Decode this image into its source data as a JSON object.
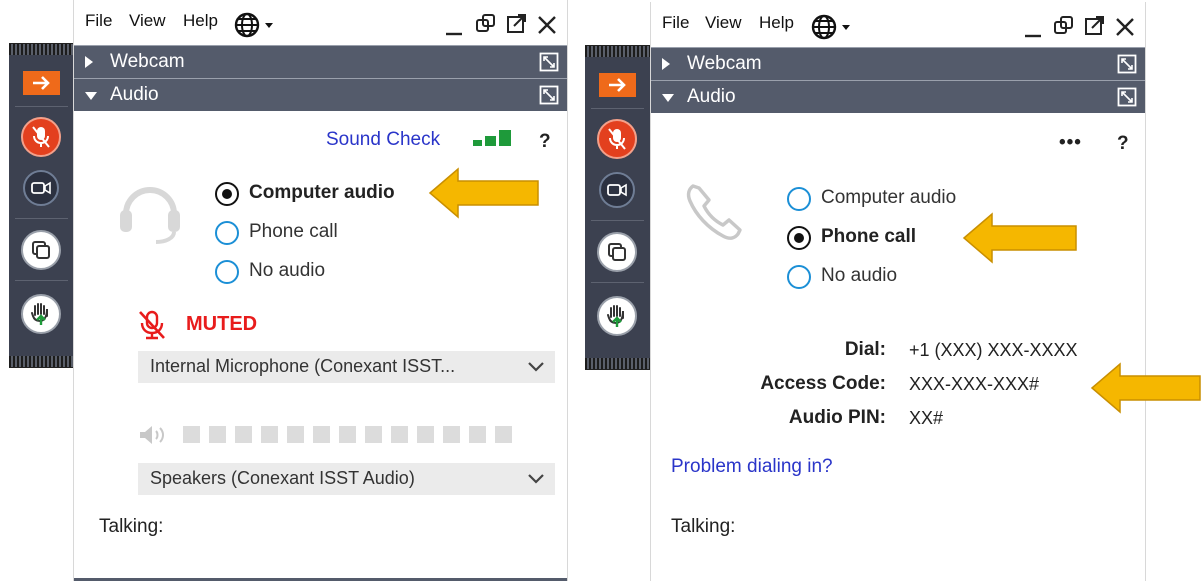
{
  "colors": {
    "toolbar_bg": "#3c4150",
    "section_bar": "#545b6b",
    "exit_orange": "#ef6a1a",
    "mic_red": "#e3401e",
    "muted_red": "#e81c1c",
    "link_blue": "#2a35c9",
    "radio_blue": "#1b8fd6",
    "signal_green": "#1e9a3a",
    "arrow_yellow": "#f5b700"
  },
  "menu": {
    "file": "File",
    "view": "View",
    "help": "Help",
    "language_icon": "globe-icon"
  },
  "window_controls": [
    "minimize-icon",
    "restore-icon",
    "popout-icon",
    "close-icon"
  ],
  "toolbar_icons": [
    "exit-arrow-icon",
    "mic-muted-icon",
    "camera-icon",
    "share-screen-icon",
    "raise-hand-icon"
  ],
  "sections": {
    "webcam": "Webcam",
    "audio": "Audio"
  },
  "left_panel": {
    "sound_check": "Sound Check",
    "help_mark": "?",
    "options": [
      {
        "label": "Computer audio",
        "selected": true
      },
      {
        "label": "Phone call",
        "selected": false
      },
      {
        "label": "No audio",
        "selected": false
      }
    ],
    "muted_label": "MUTED",
    "microphone": "Internal  Microphone  (Conexant  ISST...",
    "speaker_level_boxes": 13,
    "speakers": "Speakers (Conexant ISST Audio)",
    "talking": "Talking:"
  },
  "right_panel": {
    "more_mark": "•••",
    "help_mark": "?",
    "options": [
      {
        "label": "Computer audio",
        "selected": false
      },
      {
        "label": "Phone call",
        "selected": true
      },
      {
        "label": "No audio",
        "selected": false
      }
    ],
    "dial": {
      "label": "Dial:",
      "value": "+1 (XXX) XXX-XXXX"
    },
    "access_code": {
      "label": "Access Code:",
      "value": "XXX-XXX-XXX#"
    },
    "audio_pin": {
      "label": "Audio PIN:",
      "value": "XX#"
    },
    "problem_link": "Problem dialing in?",
    "talking": "Talking:"
  }
}
